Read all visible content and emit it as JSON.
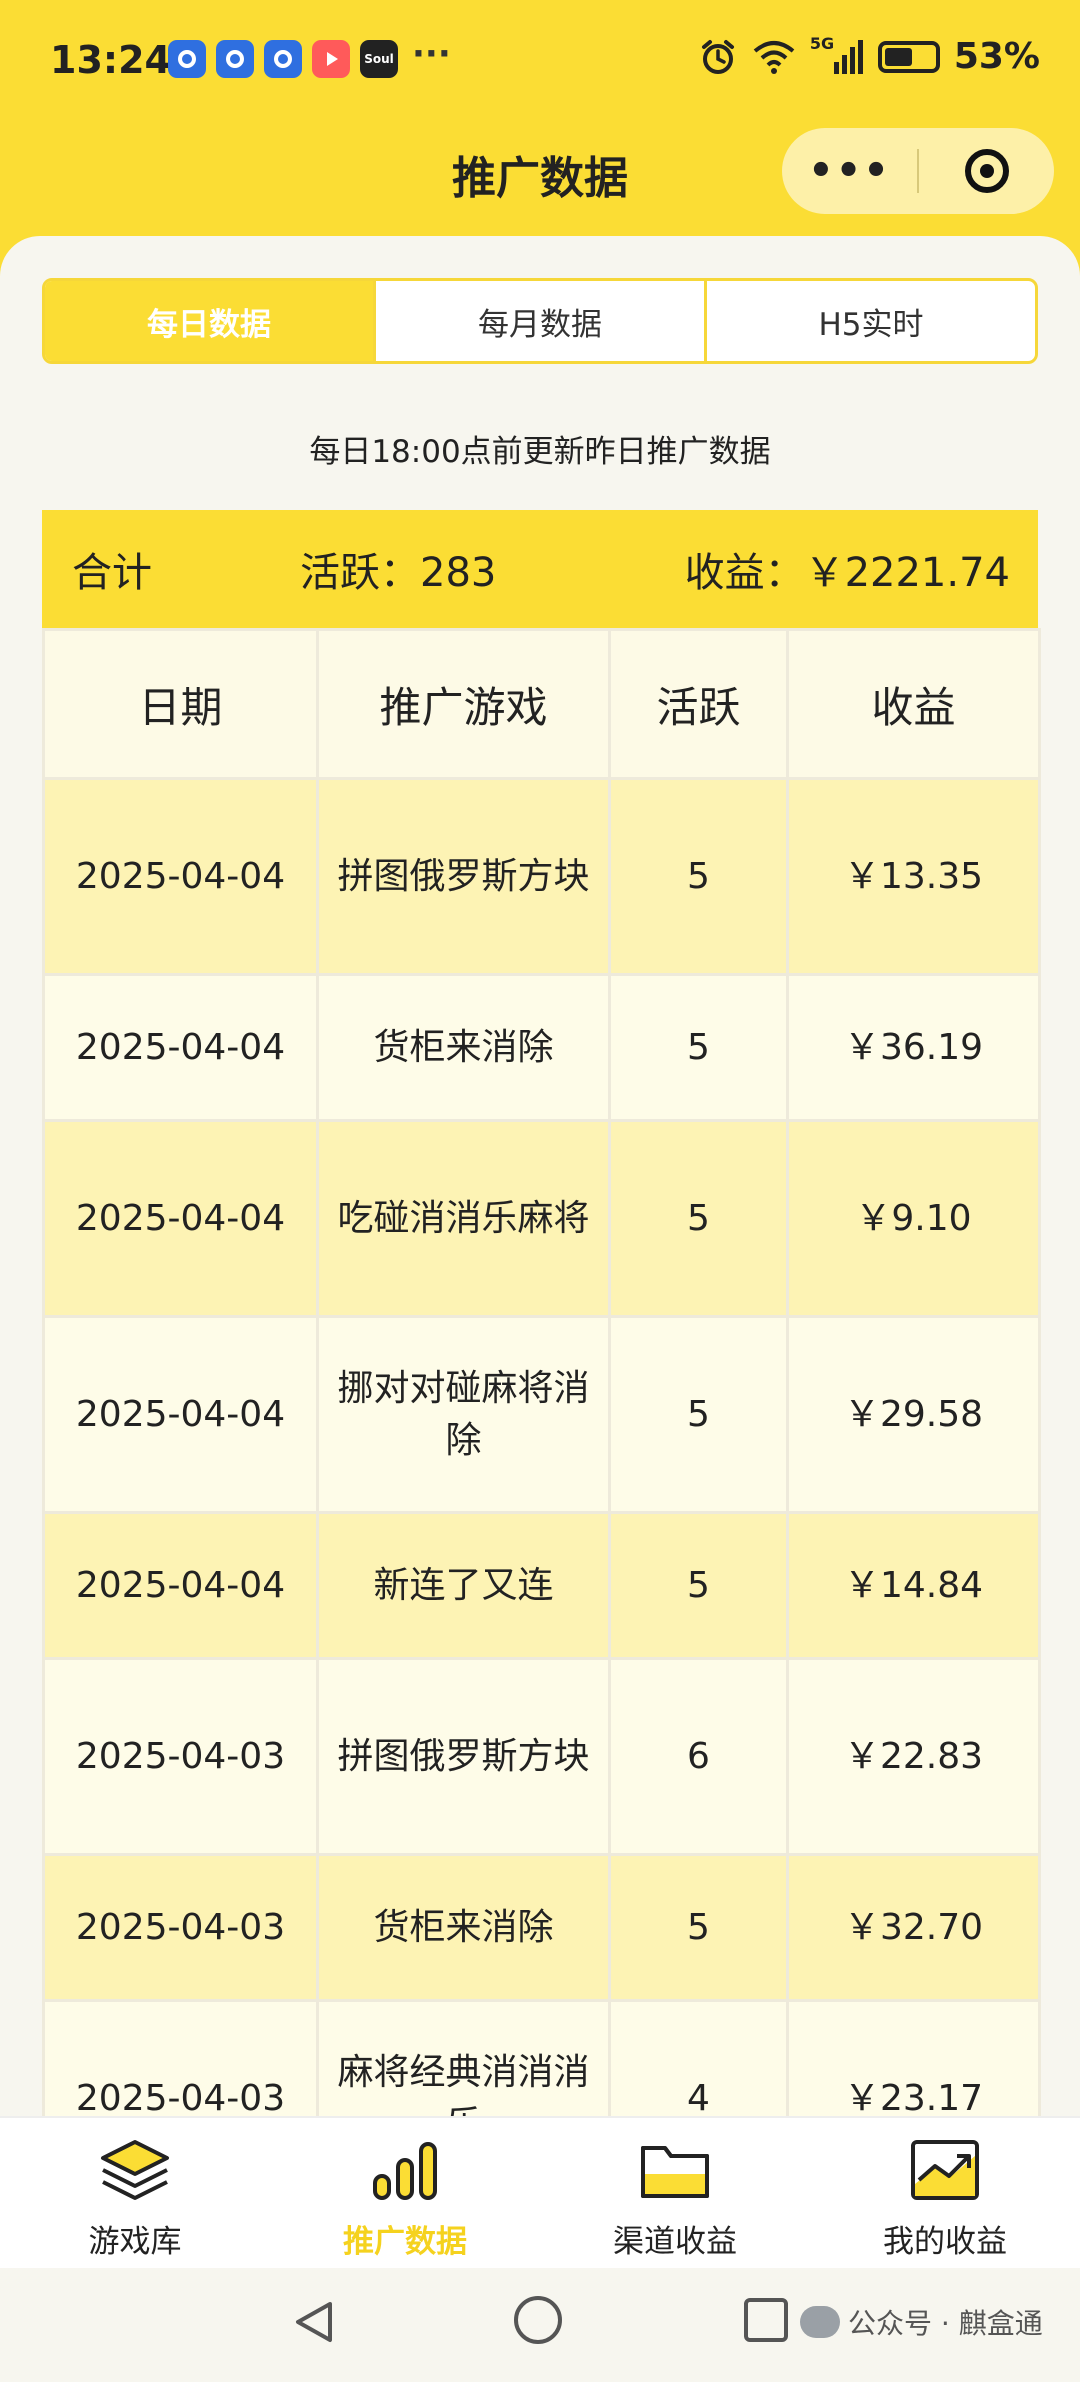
{
  "status": {
    "time": "13:24",
    "more": "···",
    "network": "5G",
    "battery": "53%",
    "battery_level": 0.53,
    "app_icons": [
      "app-icon",
      "app-icon",
      "app-icon",
      "video-app-icon",
      "soul-app-icon"
    ],
    "soul_label": "Soul"
  },
  "header": {
    "title": "推广数据",
    "more_label": "•••",
    "capsule_icons": [
      "more-icon",
      "target-icon"
    ]
  },
  "tabs": [
    {
      "label": "每日数据",
      "active": true
    },
    {
      "label": "每月数据",
      "active": false
    },
    {
      "label": "H5实时",
      "active": false
    }
  ],
  "notice": "每日18:00点前更新昨日推广数据",
  "summary": {
    "total_label": "合计",
    "active_text": "活跃：283",
    "income_text": "收益：￥2221.74"
  },
  "table": {
    "headers": [
      "日期",
      "推广游戏",
      "活跃",
      "收益"
    ],
    "rows": [
      {
        "date": "2025-04-04",
        "game": "拼图俄罗斯方块",
        "active": "5",
        "income": "￥13.35"
      },
      {
        "date": "2025-04-04",
        "game": "货柜来消除",
        "active": "5",
        "income": "￥36.19"
      },
      {
        "date": "2025-04-04",
        "game": "吃碰消消乐麻将",
        "active": "5",
        "income": "￥9.10"
      },
      {
        "date": "2025-04-04",
        "game": "挪对对碰麻将消除",
        "active": "5",
        "income": "￥29.58"
      },
      {
        "date": "2025-04-04",
        "game": "新连了又连",
        "active": "5",
        "income": "￥14.84"
      },
      {
        "date": "2025-04-03",
        "game": "拼图俄罗斯方块",
        "active": "6",
        "income": "￥22.83"
      },
      {
        "date": "2025-04-03",
        "game": "货柜来消除",
        "active": "5",
        "income": "￥32.70"
      },
      {
        "date": "2025-04-03",
        "game": "麻将经典消消消乐",
        "active": "4",
        "income": "￥23.17"
      }
    ]
  },
  "bottom_nav": [
    {
      "label": "游戏库",
      "icon": "layers-icon",
      "active": false
    },
    {
      "label": "推广数据",
      "icon": "bar-chart-icon",
      "active": true
    },
    {
      "label": "渠道收益",
      "icon": "folder-icon",
      "active": false
    },
    {
      "label": "我的收益",
      "icon": "trend-chart-icon",
      "active": false
    }
  ],
  "system_nav": {
    "icons": [
      "back-icon",
      "home-icon",
      "recents-icon"
    ],
    "watermark": "公众号 · 麒盒通"
  },
  "colors": {
    "brand_yellow": "#fbdd34",
    "row_odd": "#fdf3b4",
    "row_even": "#fefce8",
    "active_nav": "#f5d21e"
  }
}
